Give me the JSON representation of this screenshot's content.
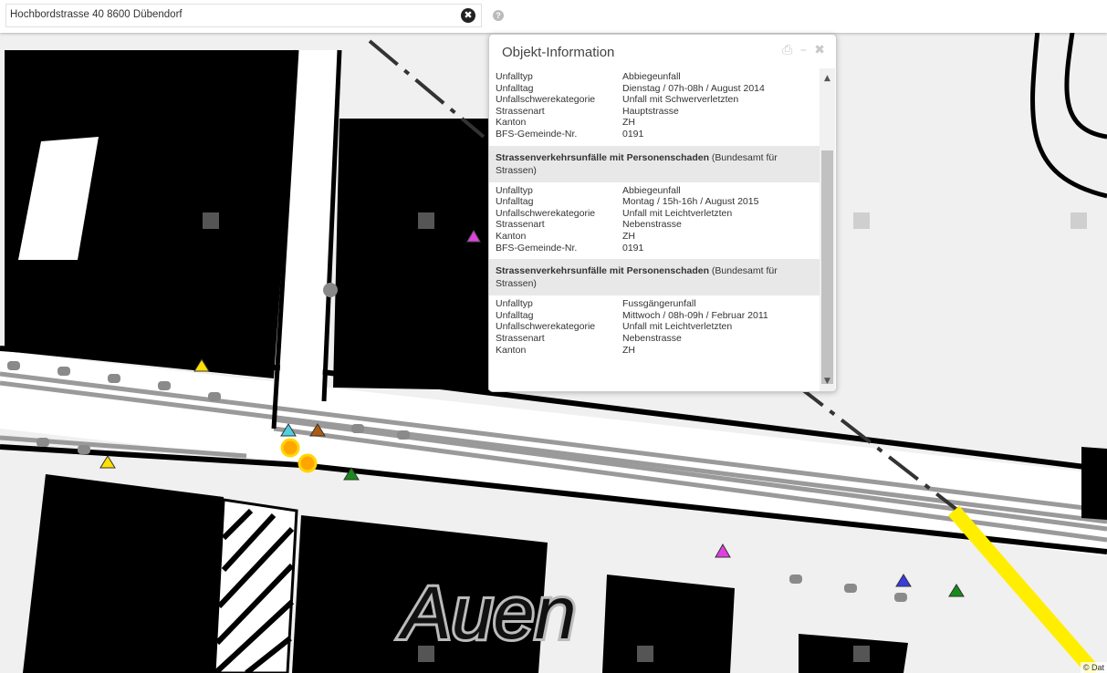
{
  "search": {
    "value": "Hochbordstrasse 40 8600 Dübendorf",
    "clear_icon": "✖",
    "help_icon": "?"
  },
  "popup": {
    "title": "Objekt-Information",
    "tools": {
      "print": "⎙",
      "minimize": "–",
      "close": "✖"
    },
    "scroll_up": "▲",
    "scroll_down": "▼",
    "first_rows": [
      {
        "k": "Unfalltyp",
        "v": "Abbiegeunfall"
      },
      {
        "k": "Unfalltag",
        "v": "Dienstag / 07h-08h / August 2014"
      },
      {
        "k": "Unfallschwerekategorie",
        "v": "Unfall mit Schwerverletzten"
      },
      {
        "k": "Strassenart",
        "v": "Hauptstrasse"
      },
      {
        "k": "Kanton",
        "v": "ZH"
      },
      {
        "k": "BFS-Gemeinde-Nr.",
        "v": "0191"
      }
    ],
    "section2": {
      "heading_bold": "Strassenverkehrsunfälle mit Personenschaden",
      "heading_rest": " (Bundesamt für Strassen)",
      "rows": [
        {
          "k": "Unfalltyp",
          "v": "Abbiegeunfall"
        },
        {
          "k": "Unfalltag",
          "v": "Montag / 15h-16h / August 2015"
        },
        {
          "k": "Unfallschwerekategorie",
          "v": "Unfall mit Leichtverletzten"
        },
        {
          "k": "Strassenart",
          "v": "Nebenstrasse"
        },
        {
          "k": "Kanton",
          "v": "ZH"
        },
        {
          "k": "BFS-Gemeinde-Nr.",
          "v": "0191"
        }
      ]
    },
    "section3": {
      "heading_bold": "Strassenverkehrsunfälle mit Personenschaden",
      "heading_rest": " (Bundesamt für Strassen)",
      "rows": [
        {
          "k": "Unfalltyp",
          "v": "Fussgängerunfall"
        },
        {
          "k": "Unfalltag",
          "v": "Mittwoch / 08h-09h / Februar 2011"
        },
        {
          "k": "Unfallschwerekategorie",
          "v": "Unfall mit Leichtverletzten"
        },
        {
          "k": "Strassenart",
          "v": "Nebenstrasse"
        },
        {
          "k": "Kanton",
          "v": "ZH"
        }
      ]
    }
  },
  "map": {
    "place_label": "Auen",
    "copyright": "© Dat"
  },
  "colors": {
    "building": "#000000",
    "road": "#ffffff",
    "track": "#9a9a9a",
    "highlight": "#ffee00"
  }
}
